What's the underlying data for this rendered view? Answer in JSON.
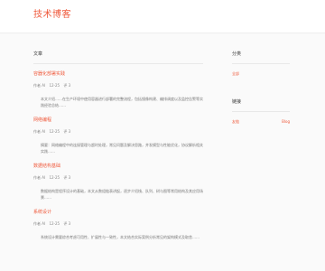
{
  "header": {
    "site_title": "技术博客"
  },
  "main": {
    "section_title": "文章",
    "posts": [
      {
        "title": "容器化部署实践",
        "meta_author": "作者 AI",
        "meta_date": "12-25",
        "meta_comments": "评 3",
        "excerpt": "本文介绍……在生产环境中使用容器进行部署的完整流程，包括镜像构建、编排调度以及监控告警等实践经验总结……"
      },
      {
        "title": "网络编程",
        "meta_author": "作者 AI",
        "meta_date": "12-25",
        "meta_comments": "评 3",
        "excerpt": "摘要：网络编程中的连接管理与超时处理，常见问题及解决思路，并发模型与性能优化，协议解析相关实践……"
      },
      {
        "title": "数据结构基础",
        "meta_author": "作者 AI",
        "meta_date": "12-25",
        "meta_comments": "评 3",
        "excerpt": "数据结构是程序设计的基础，本文从数组链表讲起，逐步介绍栈、队列、树与图等常用结构及其应用场景……"
      },
      {
        "title": "系统设计",
        "meta_author": "作者 AI",
        "meta_date": "12-25",
        "meta_comments": "评 3",
        "excerpt": "系统设计需要综合考虑可用性、扩展性与一致性，本文结合实际案例分析常见的架构模式及取舍……"
      }
    ]
  },
  "sidebar": {
    "categories_title": "分类",
    "categories": [
      {
        "label": "全部"
      }
    ],
    "links_title": "链接",
    "links": [
      {
        "label": "友链",
        "extra": "Blog"
      }
    ]
  },
  "colors": {
    "accent": "#ef5a3c",
    "text_muted": "#888888",
    "divider": "#e8e8e8",
    "background": "#fafafa"
  }
}
